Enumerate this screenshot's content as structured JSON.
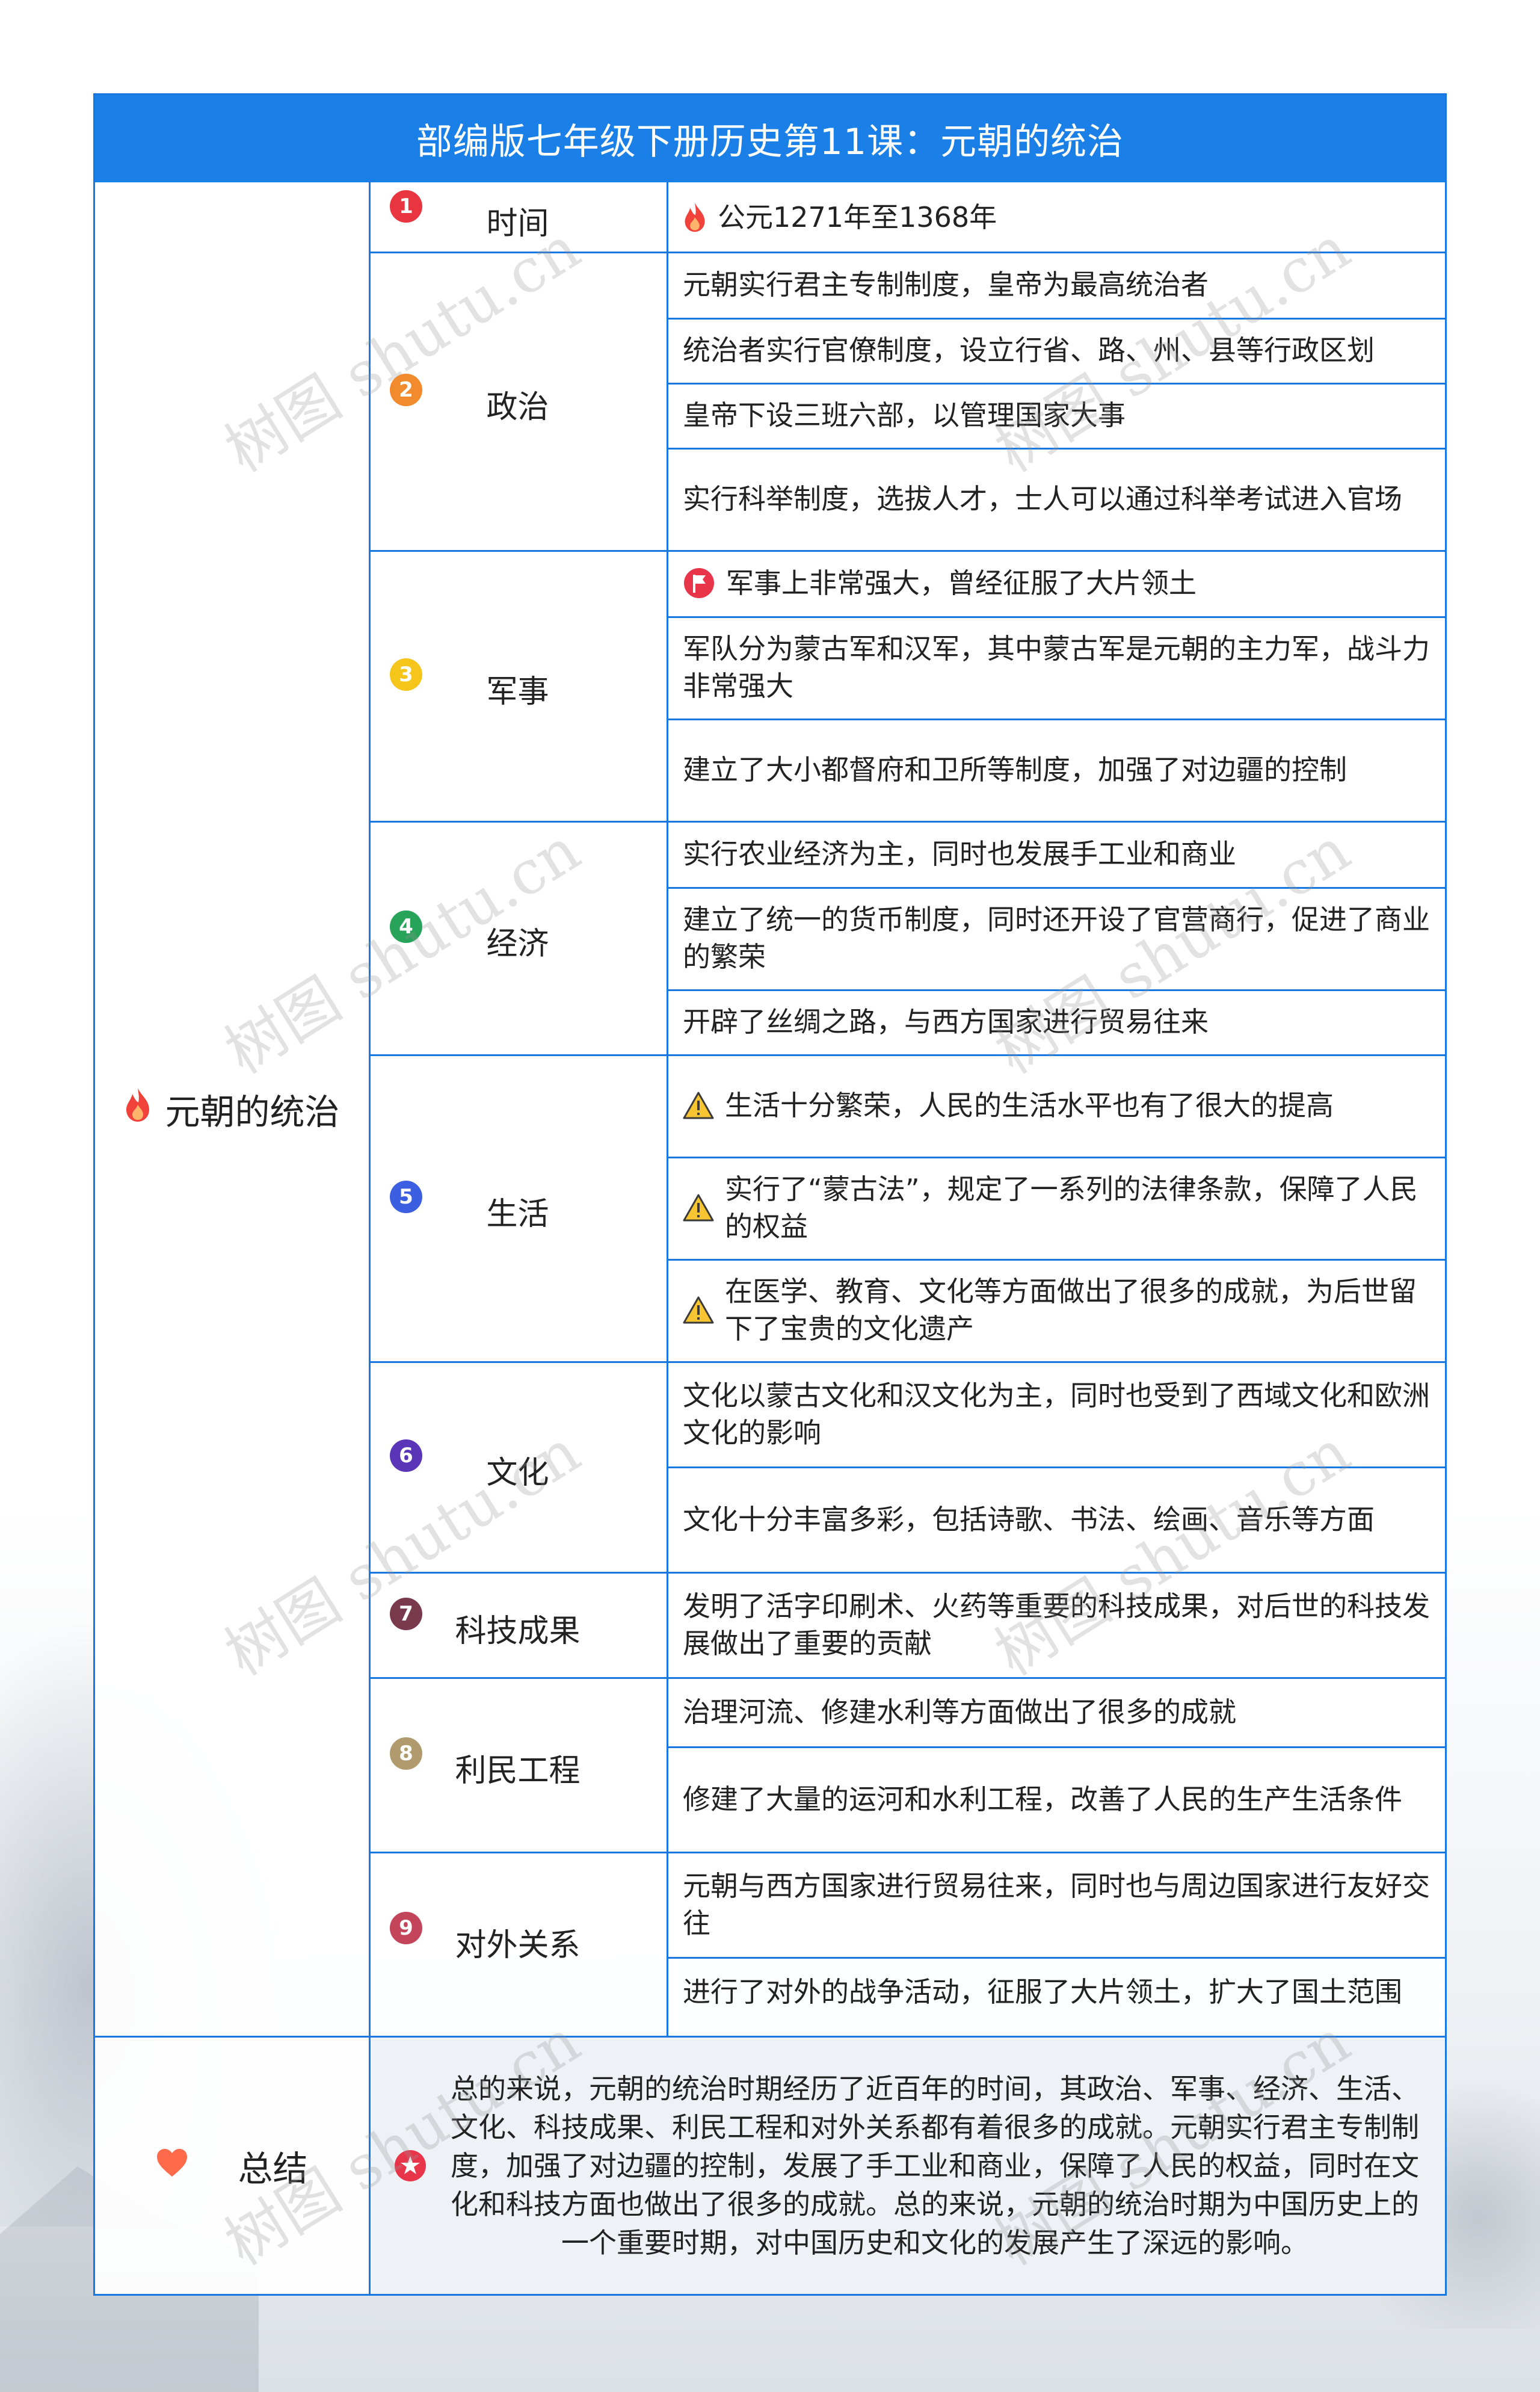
{
  "title": "部编版七年级下册历史第11课：元朝的统治",
  "main_topic": "元朝的统治",
  "summary_label": "总结",
  "summary_text": "总的来说，元朝的统治时期经历了近百年的时间，其政治、军事、经济、生活、文化、科技成果、利民工程和对外关系都有着很多的成就。元朝实行君主专制制度，加强了对边疆的控制，发展了手工业和商业，保障了人民的权益，同时在文化和科技方面也做出了很多的成就。总的来说，元朝的统治时期为中国历史上的一个重要时期，对中国历史和文化的发展产生了深远的影响。",
  "watermark": "树图 shutu.cn",
  "categories": [
    {
      "num": "1",
      "label": "时间",
      "color": "#e8353f",
      "items": [
        "公元1271年至1368年"
      ]
    },
    {
      "num": "2",
      "label": "政治",
      "color": "#f28a2e",
      "items": [
        "元朝实行君主专制制度，皇帝为最高统治者",
        "统治者实行官僚制度，设立行省、路、州、县等行政区划",
        "皇帝下设三班六部，以管理国家大事",
        "实行科举制度，选拔人才，士人可以通过科举考试进入官场"
      ]
    },
    {
      "num": "3",
      "label": "军事",
      "color": "#f5c51b",
      "items": [
        "军事上非常强大，曾经征服了大片领土",
        "军队分为蒙古军和汉军，其中蒙古军是元朝的主力军，战斗力非常强大",
        "建立了大小都督府和卫所等制度，加强了对边疆的控制"
      ]
    },
    {
      "num": "4",
      "label": "经济",
      "color": "#27a35a",
      "items": [
        "实行农业经济为主，同时也发展手工业和商业",
        "建立了统一的货币制度，同时还开设了官营商行，促进了商业的繁荣",
        "开辟了丝绸之路，与西方国家进行贸易往来"
      ]
    },
    {
      "num": "5",
      "label": "生活",
      "color": "#3b5fe0",
      "items": [
        "生活十分繁荣，人民的生活水平也有了很大的提高",
        "实行了“蒙古法”，规定了一系列的法律条款，保障了人民的权益",
        "在医学、教育、文化等方面做出了很多的成就，为后世留下了宝贵的文化遗产"
      ]
    },
    {
      "num": "6",
      "label": "文化",
      "color": "#5a35b8",
      "items": [
        "文化以蒙古文化和汉文化为主，同时也受到了西域文化和欧洲文化的影响",
        "文化十分丰富多彩，包括诗歌、书法、绘画、音乐等方面"
      ]
    },
    {
      "num": "7",
      "label": "科技成果",
      "color": "#7a3a4e",
      "items": [
        "发明了活字印刷术、火药等重要的科技成果，对后世的科技发展做出了重要的贡献"
      ]
    },
    {
      "num": "8",
      "label": "利民工程",
      "color": "#b09a6e",
      "items": [
        "治理河流、修建水利等方面做出了很多的成就",
        "修建了大量的运河和水利工程，改善了人民的生产生活条件"
      ]
    },
    {
      "num": "9",
      "label": "对外关系",
      "color": "#c2455a",
      "items": [
        "元朝与西方国家进行贸易往来，同时也与周边国家进行友好交往",
        "进行了对外的战争活动，征服了大片领土，扩大了国土范围"
      ]
    }
  ],
  "icons": {
    "main": "fire-icon",
    "time_item": "fire-icon",
    "military_first": "flag-icon",
    "life_items": "warning-icon",
    "summary": "heart-icon",
    "summary_text": "star-badge-icon"
  },
  "colors": {
    "border": "#1877e0",
    "title_bg": "#1a7fe6",
    "summary_bg": "#eef2f6"
  }
}
